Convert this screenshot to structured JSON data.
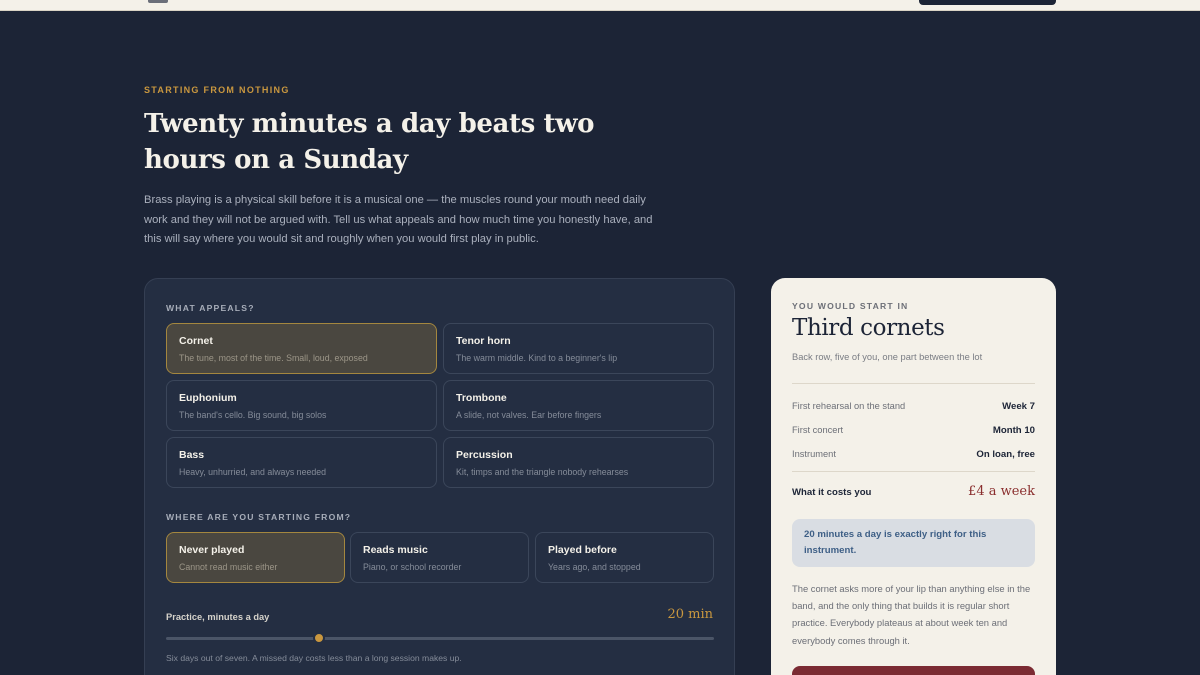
{
  "hero": {
    "eyebrow": "STARTING FROM NOTHING",
    "headline": "Twenty minutes a day beats two hours on a Sunday",
    "intro": "Brass playing is a physical skill before it is a musical one — the muscles round your mouth need daily work and they will not be argued with. Tell us what appeals and how much time you honestly have, and this will say where you would sit and roughly when you would first play in public."
  },
  "appeals": {
    "label": "WHAT APPEALS?",
    "selected_index": 0,
    "options": [
      {
        "title": "Cornet",
        "desc": "The tune, most of the time. Small, loud, exposed"
      },
      {
        "title": "Tenor horn",
        "desc": "The warm middle. Kind to a beginner's lip"
      },
      {
        "title": "Euphonium",
        "desc": "The band's cello. Big sound, big solos"
      },
      {
        "title": "Trombone",
        "desc": "A slide, not valves. Ear before fingers"
      },
      {
        "title": "Bass",
        "desc": "Heavy, unhurried, and always needed"
      },
      {
        "title": "Percussion",
        "desc": "Kit, timps and the triangle nobody rehearses"
      }
    ]
  },
  "starting": {
    "label": "WHERE ARE YOU STARTING FROM?",
    "selected_index": 0,
    "options": [
      {
        "title": "Never played",
        "desc": "Cannot read music either"
      },
      {
        "title": "Reads music",
        "desc": "Piano, or school recorder"
      },
      {
        "title": "Played before",
        "desc": "Years ago, and stopped"
      }
    ]
  },
  "practice": {
    "label": "Practice, minutes a day",
    "value_text": "20 min",
    "level_fraction": 0.28,
    "note": "Six days out of seven. A missed day costs less than a long session makes up."
  },
  "result": {
    "eyebrow": "YOU WOULD START IN",
    "title": "Third cornets",
    "subtitle": "Back row, five of you, one part between the lot",
    "rows": [
      {
        "key": "First rehearsal on the stand",
        "value": "Week 7"
      },
      {
        "key": "First concert",
        "value": "Month 10"
      },
      {
        "key": "Instrument",
        "value": "On loan, free"
      }
    ],
    "cost_key": "What it costs you",
    "cost_value": "£4 a week",
    "tip": "20 minutes a day is exactly right for this instrument.",
    "body": "The cornet asks more of your lip than anything else in the band, and the only thing that builds it is regular short practice. Everybody plateaus at about week ten and everybody comes through it."
  }
}
